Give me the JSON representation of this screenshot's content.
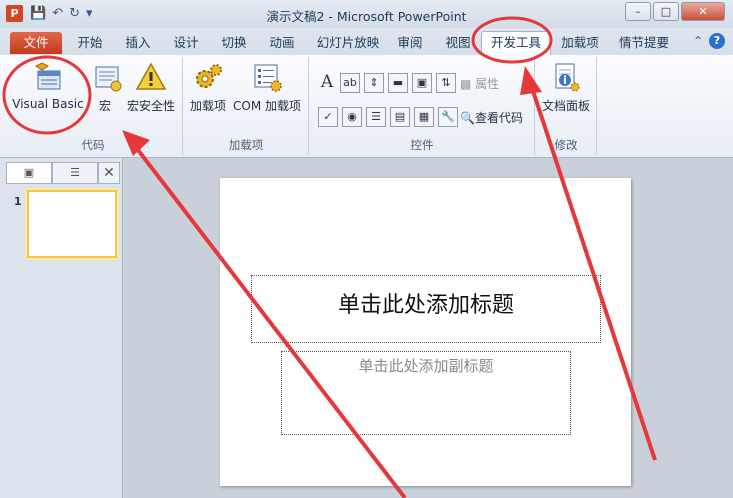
{
  "window": {
    "title": "演示文稿2 - Microsoft PowerPoint",
    "app_icon_letter": "P"
  },
  "tabs": [
    {
      "label": "文件"
    },
    {
      "label": "开始"
    },
    {
      "label": "插入"
    },
    {
      "label": "设计"
    },
    {
      "label": "切换"
    },
    {
      "label": "动画"
    },
    {
      "label": "幻灯片放映"
    },
    {
      "label": "审阅"
    },
    {
      "label": "视图"
    },
    {
      "label": "开发工具"
    },
    {
      "label": "加载项"
    },
    {
      "label": "情节提要"
    }
  ],
  "ribbon": {
    "code_group": {
      "label": "代码",
      "visual_basic": "Visual Basic",
      "macros": "宏",
      "macro_security": "宏安全性"
    },
    "addins_group": {
      "label": "加载项",
      "addins": "加载项",
      "com_addins": "COM 加载项"
    },
    "controls_group": {
      "label": "控件",
      "properties": "属性",
      "view_code": "查看代码"
    },
    "modify_group": {
      "label": "修改",
      "document_panel": "文档面板"
    }
  },
  "slide": {
    "number": "1",
    "title_placeholder": "单击此处添加标题",
    "subtitle_placeholder": "单击此处添加副标题"
  },
  "colors": {
    "file_tab": "#c9421f",
    "annotation": "#e5383b"
  }
}
